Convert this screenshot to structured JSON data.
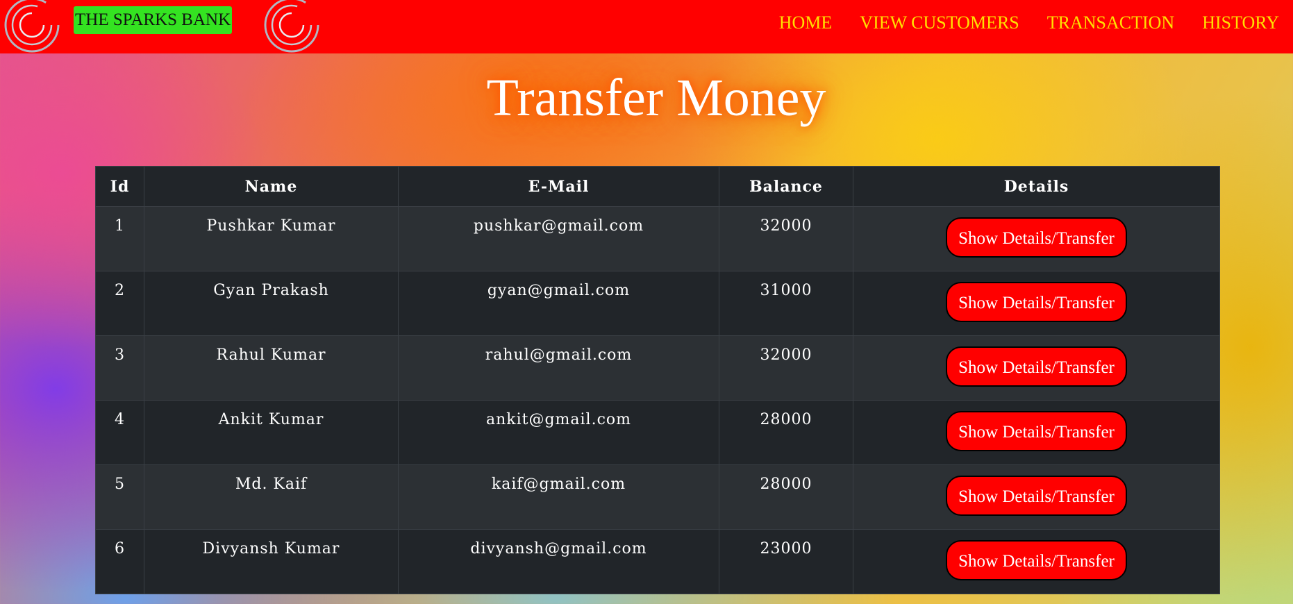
{
  "navbar": {
    "brand": "THE SPARKS BANK",
    "links": [
      "HOME",
      "VIEW CUSTOMERS",
      "TRANSACTION",
      "HISTORY"
    ],
    "logo_icon": "spiral-ring-icon",
    "colors": {
      "background": "#ff0000",
      "link": "#ffe000",
      "brand_bg": "#34e321"
    }
  },
  "page": {
    "title": "Transfer Money"
  },
  "table": {
    "headers": [
      "Id",
      "Name",
      "E-Mail",
      "Balance",
      "Details"
    ],
    "rows": [
      {
        "id": "1",
        "name": "Pushkar Kumar",
        "email": "pushkar@gmail.com",
        "balance": "32000",
        "action": "Show Details/Transfer"
      },
      {
        "id": "2",
        "name": "Gyan Prakash",
        "email": "gyan@gmail.com",
        "balance": "31000",
        "action": "Show Details/Transfer"
      },
      {
        "id": "3",
        "name": "Rahul Kumar",
        "email": "rahul@gmail.com",
        "balance": "32000",
        "action": "Show Details/Transfer"
      },
      {
        "id": "4",
        "name": "Ankit Kumar",
        "email": "ankit@gmail.com",
        "balance": "28000",
        "action": "Show Details/Transfer"
      },
      {
        "id": "5",
        "name": "Md. Kaif",
        "email": "kaif@gmail.com",
        "balance": "28000",
        "action": "Show Details/Transfer"
      },
      {
        "id": "6",
        "name": "Divyansh Kumar",
        "email": "divyansh@gmail.com",
        "balance": "23000",
        "action": "Show Details/Transfer"
      }
    ],
    "colors": {
      "row_dark": "#212529",
      "row_light": "#2c3034",
      "button": "#ff0000"
    }
  }
}
